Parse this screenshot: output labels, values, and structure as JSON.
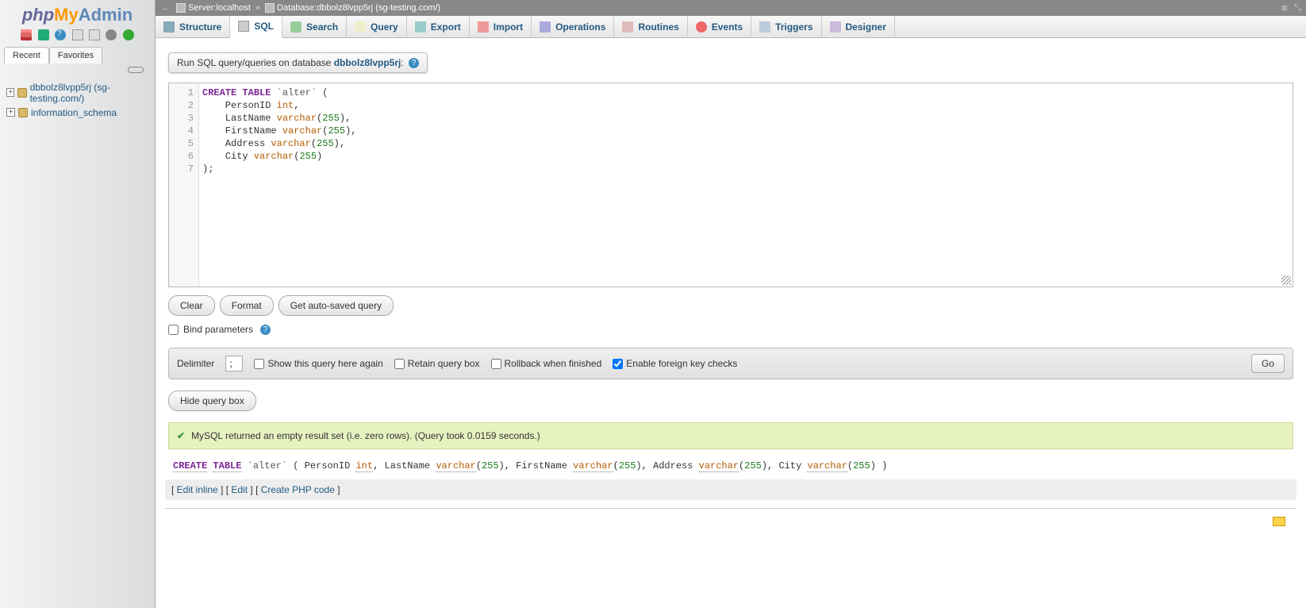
{
  "logo": {
    "p1": "php",
    "p2": "My",
    "p3": "Admin"
  },
  "sidebarTabs": {
    "recent": "Recent",
    "favorites": "Favorites"
  },
  "navItems": [
    {
      "label": "dbbolz8lvpp5rj (sg-testing.com/)"
    },
    {
      "label": "information_schema"
    }
  ],
  "breadcrumb": {
    "server_label": "Server: ",
    "server_val": "localhost",
    "db_label": "Database: ",
    "db_val": "dbbolz8lvpp5rj (sg-testing.com/)"
  },
  "tabs": [
    "Structure",
    "SQL",
    "Search",
    "Query",
    "Export",
    "Import",
    "Operations",
    "Routines",
    "Events",
    "Triggers",
    "Designer"
  ],
  "active_tab": 1,
  "query_label_prefix": "Run SQL query/queries on database ",
  "query_label_db": "dbbolz8lvpp5rj",
  "query_label_suffix": ":",
  "sql_lines": [
    [
      {
        "t": "CREATE",
        "c": "kw"
      },
      {
        "t": " "
      },
      {
        "t": "TABLE",
        "c": "kw"
      },
      {
        "t": " "
      },
      {
        "t": "`alter`",
        "c": "str"
      },
      {
        "t": " ("
      }
    ],
    [
      {
        "t": "    PersonID "
      },
      {
        "t": "int",
        "c": "ty"
      },
      {
        "t": ","
      }
    ],
    [
      {
        "t": "    LastName "
      },
      {
        "t": "varchar",
        "c": "ty"
      },
      {
        "t": "("
      },
      {
        "t": "255",
        "c": "num"
      },
      {
        "t": "),"
      }
    ],
    [
      {
        "t": "    FirstName "
      },
      {
        "t": "varchar",
        "c": "ty"
      },
      {
        "t": "("
      },
      {
        "t": "255",
        "c": "num"
      },
      {
        "t": "),"
      }
    ],
    [
      {
        "t": "    Address "
      },
      {
        "t": "varchar",
        "c": "ty"
      },
      {
        "t": "("
      },
      {
        "t": "255",
        "c": "num"
      },
      {
        "t": "),"
      }
    ],
    [
      {
        "t": "    City "
      },
      {
        "t": "varchar",
        "c": "ty"
      },
      {
        "t": "("
      },
      {
        "t": "255",
        "c": "num"
      },
      {
        "t": ")"
      }
    ],
    [
      {
        "t": ");"
      }
    ]
  ],
  "buttons": {
    "clear": "Clear",
    "format": "Format",
    "autosaved": "Get auto-saved query"
  },
  "bind_params": "Bind parameters",
  "opts": {
    "delimiter_label": "Delimiter",
    "delimiter_val": ";",
    "show_again": "Show this query here again",
    "retain": "Retain query box",
    "rollback": "Rollback when finished",
    "fk": "Enable foreign key checks",
    "go": "Go"
  },
  "hide_q": "Hide query box",
  "success": "MySQL returned an empty result set (i.e. zero rows). (Query took 0.0159 seconds.)",
  "echo": [
    {
      "t": "CREATE",
      "c": "kw u"
    },
    {
      "t": " "
    },
    {
      "t": "TABLE",
      "c": "kw u"
    },
    {
      "t": " "
    },
    {
      "t": "`alter`",
      "c": "str"
    },
    {
      "t": " ( PersonID "
    },
    {
      "t": "int",
      "c": "ty u"
    },
    {
      "t": ", LastName "
    },
    {
      "t": "varchar",
      "c": "ty u"
    },
    {
      "t": "("
    },
    {
      "t": "255",
      "c": "num"
    },
    {
      "t": "), FirstName "
    },
    {
      "t": "varchar",
      "c": "ty u"
    },
    {
      "t": "("
    },
    {
      "t": "255",
      "c": "num"
    },
    {
      "t": "), Address "
    },
    {
      "t": "varchar",
      "c": "ty u"
    },
    {
      "t": "("
    },
    {
      "t": "255",
      "c": "num"
    },
    {
      "t": "), City "
    },
    {
      "t": "varchar",
      "c": "ty u"
    },
    {
      "t": "("
    },
    {
      "t": "255",
      "c": "num"
    },
    {
      "t": ") )"
    }
  ],
  "links": {
    "edit_inline": "Edit inline",
    "edit": "Edit",
    "create_php": "Create PHP code"
  }
}
